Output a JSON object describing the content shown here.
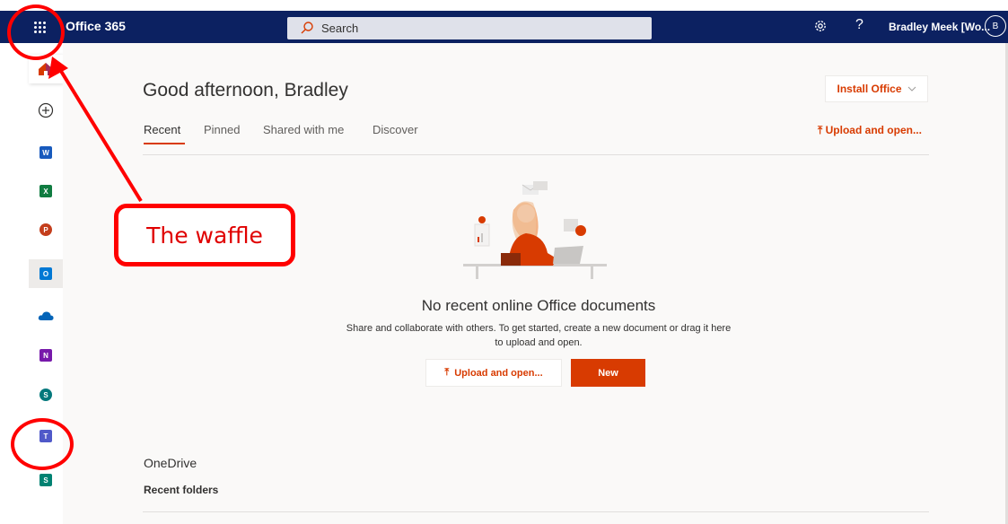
{
  "topbar": {
    "brand": "Office 365",
    "search_placeholder": "Search",
    "help_glyph": "?",
    "user_name": "Bradley Meek [Wo...",
    "avatar_initial": "B"
  },
  "rail": {
    "items": [
      {
        "name": "home",
        "icon": "home-icon",
        "color": "#d83b01"
      },
      {
        "name": "create",
        "icon": "plus-circle-icon"
      },
      {
        "name": "word",
        "icon": "word-icon",
        "letter": "W",
        "color": "#185abd"
      },
      {
        "name": "excel",
        "icon": "excel-icon",
        "letter": "X",
        "color": "#107c41"
      },
      {
        "name": "powerpoint",
        "icon": "powerpoint-icon",
        "letter": "P",
        "color": "#c43e1c"
      },
      {
        "name": "outlook",
        "icon": "outlook-icon",
        "letter": "O",
        "color": "#0078d4"
      },
      {
        "name": "onedrive",
        "icon": "onedrive-icon",
        "color": "#0364b8"
      },
      {
        "name": "onenote",
        "icon": "onenote-icon",
        "letter": "N",
        "color": "#7719aa"
      },
      {
        "name": "sharepoint",
        "icon": "sharepoint-icon",
        "letter": "S",
        "color": "#03787c"
      },
      {
        "name": "teams",
        "icon": "teams-icon",
        "letter": "T",
        "color": "#5059c9"
      },
      {
        "name": "sway",
        "icon": "sway-icon",
        "letter": "S",
        "color": "#008272"
      }
    ]
  },
  "main": {
    "greeting": "Good afternoon, Bradley",
    "install_label": "Install Office",
    "tabs": [
      {
        "label": "Recent",
        "active": true
      },
      {
        "label": "Pinned",
        "active": false
      },
      {
        "label": "Shared with me",
        "active": false
      },
      {
        "label": "Discover",
        "active": false
      }
    ],
    "upload_open_label": "Upload and open...",
    "empty_title": "No recent online Office documents",
    "empty_body": "Share and collaborate with others. To get started, create a new document or drag it here to upload and open.",
    "upload_button_label": "Upload and open...",
    "new_button_label": "New",
    "onedrive_title": "OneDrive",
    "recent_folders_label": "Recent folders"
  },
  "annotation": {
    "label": "The waffle",
    "color": "#ff0000"
  },
  "colors": {
    "topbar": "#0c2161",
    "accent": "#d83b01",
    "background": "#faf9f8"
  }
}
